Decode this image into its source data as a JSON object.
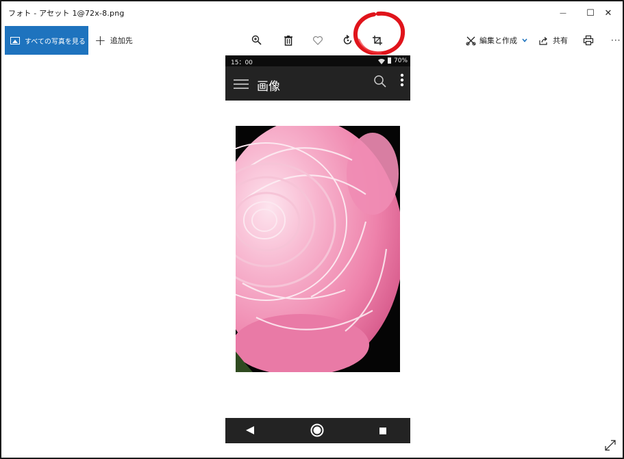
{
  "window": {
    "title": "フォト - アセット 1@72x-8.png",
    "controls": {
      "minimize": "—",
      "maximize": "☐",
      "close": "✕"
    }
  },
  "toolbar": {
    "see_all_label": "すべての写真を見る",
    "add_to_label": "追加先",
    "edit_create_label": "編集と作成",
    "share_label": "共有",
    "more_label": "···",
    "icons": [
      "zoom-icon",
      "delete-icon",
      "favorite-icon",
      "rotate-icon",
      "crop-icon"
    ]
  },
  "phone": {
    "status_time": "15：00",
    "battery": "70%",
    "app_title": "画像"
  },
  "colors": {
    "accent": "#1e73be",
    "annotation": "#e0141b",
    "phone_bar": "#232323",
    "flower_pink": "#f08cb4"
  }
}
